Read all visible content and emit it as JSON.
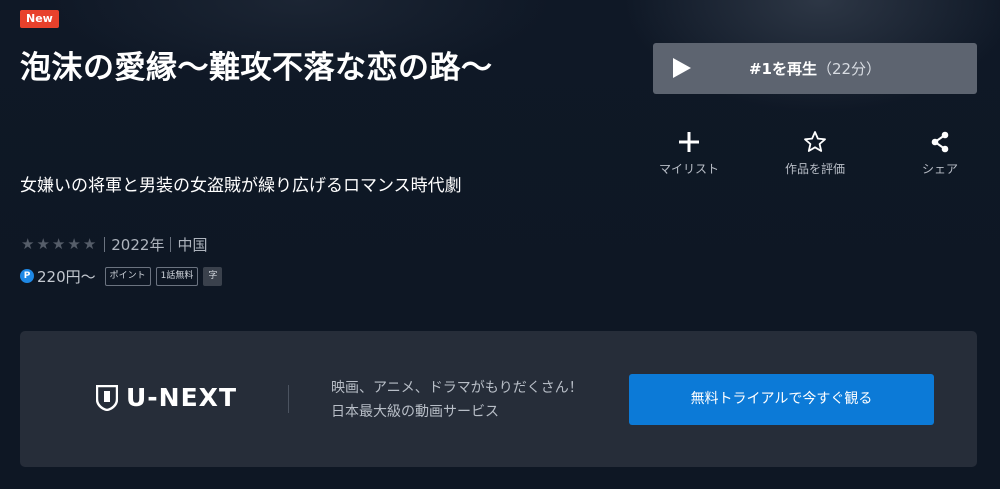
{
  "badge": "New",
  "title": "泡沫の愛縁～難攻不落な恋の路～",
  "catchcopy": "女嫌いの将軍と男装の女盗賊が繰り広げるロマンス時代劇",
  "rating": {
    "stars": 0,
    "max": 5
  },
  "year": "2022年",
  "country": "中国",
  "price": "220円～",
  "tags": [
    "ポイント",
    "1話無料",
    "字"
  ],
  "play": {
    "label": "#1を再生",
    "duration": "（22分）"
  },
  "actions": [
    {
      "icon": "plus-icon",
      "label": "マイリスト"
    },
    {
      "icon": "star-outline-icon",
      "label": "作品を評価"
    },
    {
      "icon": "share-icon",
      "label": "シェア"
    }
  ],
  "promo": {
    "logo": "U-NEXT",
    "line1": "映画、アニメ、ドラマがもりだくさん！",
    "line2": "日本最大級の動画サービス",
    "cta": "無料トライアルで今すぐ観る"
  },
  "colors": {
    "badge": "#e8412c",
    "cta": "#0c7ad7",
    "play_button": "#5d6470",
    "background": "#0e1724"
  }
}
